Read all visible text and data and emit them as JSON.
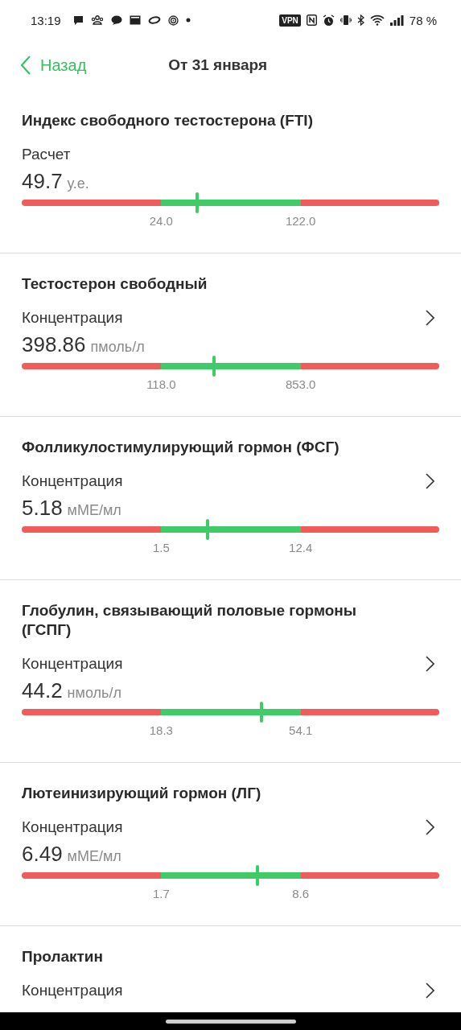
{
  "status_bar": {
    "time": "13:19",
    "vpn": "VPN",
    "battery": "78 %"
  },
  "header": {
    "back": "Назад",
    "title": "От 31 января"
  },
  "cards": [
    {
      "title": "Индекс свободного тестостерона (FTI)",
      "label": "Расчет",
      "chevron": false,
      "value": "49.7",
      "unit": "у.е.",
      "low": "24.0",
      "high": "122.0",
      "level": 0.42
    },
    {
      "title": "Тестостерон свободный",
      "label": "Концентрация",
      "chevron": true,
      "value": "398.86",
      "unit": "пмоль/л",
      "low": "118.0",
      "high": "853.0",
      "level": 0.461
    },
    {
      "title": "Фолликулостимулирующий гормон (ФСГ)",
      "label": "Концентрация",
      "chevron": true,
      "value": "5.18",
      "unit": "мМЕ/мл",
      "low": "1.5",
      "high": "12.4",
      "level": 0.445
    },
    {
      "title": "Глобулин, связывающий половые гормоны (ГСПГ)",
      "label": "Концентрация",
      "chevron": true,
      "value": "44.2",
      "unit": "нмоль/л",
      "low": "18.3",
      "high": "54.1",
      "level": 0.574
    },
    {
      "title": "Лютеинизирующий гормон (ЛГ)",
      "label": "Концентрация",
      "chevron": true,
      "value": "6.49",
      "unit": "мМЕ/мл",
      "low": "1.7",
      "high": "8.6",
      "level": 0.564
    },
    {
      "title": "Пролактин",
      "label": "Концентрация",
      "chevron": true
    }
  ]
}
